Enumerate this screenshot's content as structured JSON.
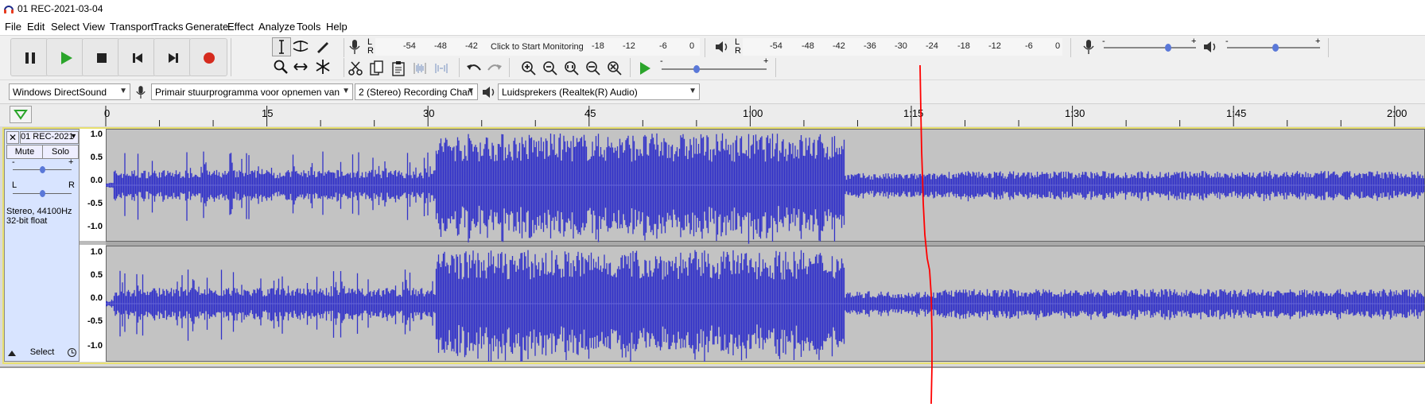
{
  "window": {
    "title": "01 REC-2021-03-04"
  },
  "menu": [
    "File",
    "Edit",
    "Select",
    "View",
    "Transport",
    "Tracks",
    "Generate",
    "Effect",
    "Analyze",
    "Tools",
    "Help"
  ],
  "meters": {
    "record_scale": [
      "-54",
      "-48",
      "-42",
      "-18",
      "-12",
      "-6",
      "0"
    ],
    "record_hint": "Click to Start Monitoring",
    "play_scale": [
      "-54",
      "-48",
      "-42",
      "-36",
      "-30",
      "-24",
      "-18",
      "-12",
      "-6",
      "0"
    ],
    "channel_l": "L",
    "channel_r": "R"
  },
  "sliders": {
    "minus": "-",
    "plus": "+"
  },
  "devices": {
    "host": "Windows DirectSound",
    "record_device": "Primair stuurprogramma voor opnemen van",
    "channels": "2 (Stereo) Recording Chan",
    "playback_device": "Luidsprekers (Realtek(R) Audio)"
  },
  "ruler": {
    "ticks": [
      "0",
      "15",
      "30",
      "45",
      "1:00",
      "1:15",
      "1:30",
      "1:45",
      "2:00"
    ]
  },
  "track": {
    "name": "01 REC-2021",
    "mute": "Mute",
    "solo": "Solo",
    "gain_minus": "-",
    "gain_plus": "+",
    "pan_l": "L",
    "pan_r": "R",
    "info_line1": "Stereo, 44100Hz",
    "info_line2": "32-bit float",
    "select": "Select"
  },
  "vertical_scale": [
    "1.0",
    "0.5",
    "0.0",
    "-0.5",
    "-1.0"
  ],
  "colors": {
    "waveform": "#3232c8",
    "waveform_light": "#6464dc",
    "track_bg": "#c3c3c3",
    "record": "#d52b1e",
    "play": "#2ba52b",
    "annotation": "#ff0000"
  }
}
